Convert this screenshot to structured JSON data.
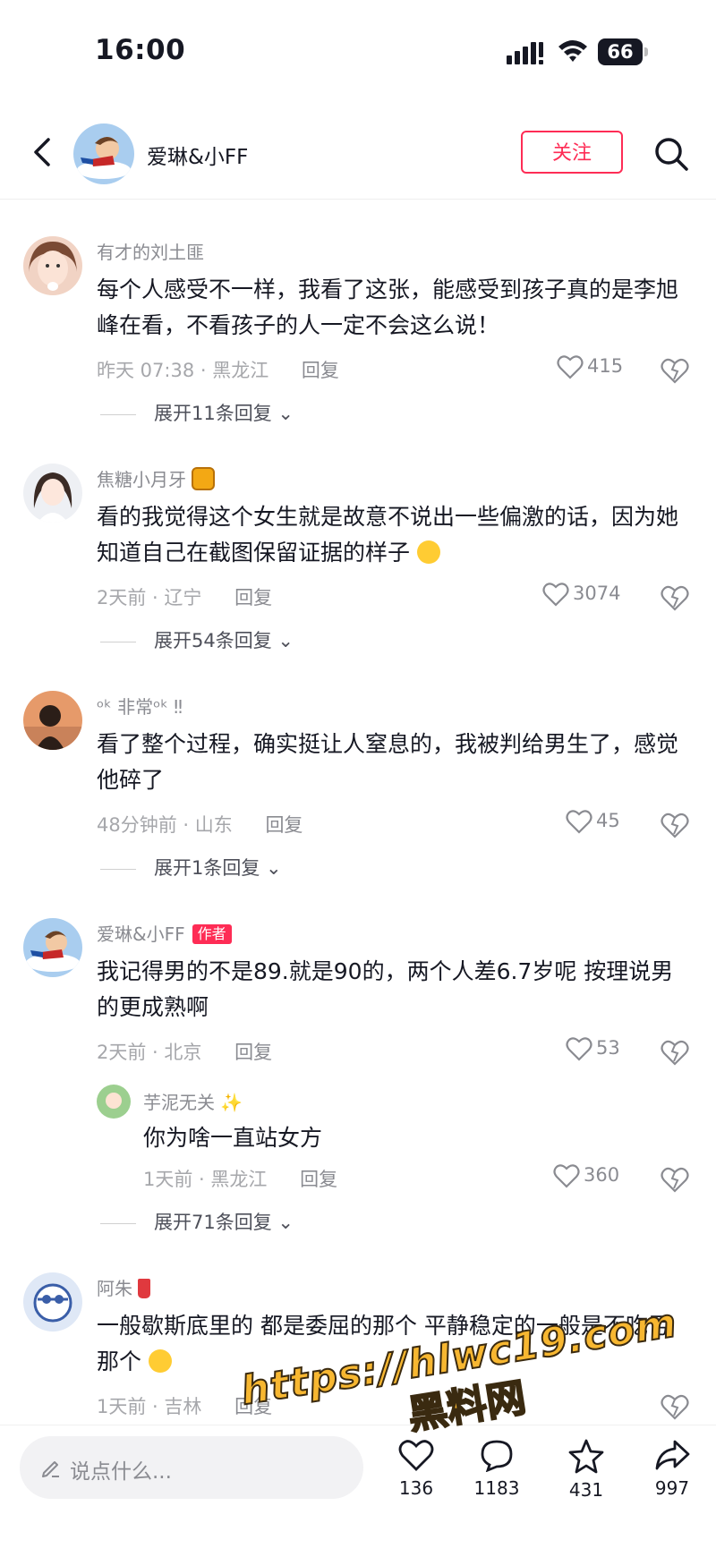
{
  "status_bar": {
    "time": "16:00",
    "battery": "66"
  },
  "header": {
    "account_name": "爱琳&小FF",
    "follow_label": "关注"
  },
  "comments": [
    {
      "user": "有才的刘土匪",
      "text": "每个人感受不一样，我看了这张，能感受到孩子真的是李旭峰在看，不看孩子的人一定不会这么说！",
      "meta": "昨天 07:38 · 黑龙江",
      "reply_label": "回复",
      "likes": "415",
      "expand": "展开11条回复"
    },
    {
      "user": "焦糖小月牙",
      "text": "看的我觉得这个女生就是故意不说出一些偏激的话，因为她知道自己在截图保留证据的样子",
      "meta": "2天前 · 辽宁",
      "reply_label": "回复",
      "likes": "3074",
      "expand": "展开54条回复"
    },
    {
      "user": "ᵒᵏ 非常ᵒᵏ ‼",
      "text": "看了整个过程，确实挺让人窒息的，我被判给男生了，感觉他碎了",
      "meta": "48分钟前 · 山东",
      "reply_label": "回复",
      "likes": "45",
      "expand": "展开1条回复"
    },
    {
      "user": "爱琳&小FF",
      "author_tag": "作者",
      "text": "我记得男的不是89.就是90的，两个人差6.7岁呢  按理说男的更成熟啊",
      "meta": "2天前 · 北京",
      "reply_label": "回复",
      "likes": "53",
      "sub_reply": {
        "user": "芋泥无关",
        "text": "你为啥一直站女方",
        "meta": "1天前 · 黑龙江",
        "reply_label": "回复",
        "likes": "360"
      },
      "expand": "展开71条回复"
    },
    {
      "user": "阿朱",
      "text": "一般歇斯底里的 都是委屈的那个 平静稳定的一般是不吃亏那个",
      "meta": "1天前 · 吉林",
      "reply_label": "回复"
    }
  ],
  "bottom_bar": {
    "input_placeholder": "说点什么...",
    "like_count": "136",
    "comment_count": "1183",
    "favorite_count": "431",
    "share_count": "997"
  },
  "watermark": {
    "url": "https://hlwc19.com",
    "name": "黑料网"
  },
  "colors": {
    "accent": "#fe2c55",
    "text": "#161823",
    "secondary": "#8a8b91"
  }
}
